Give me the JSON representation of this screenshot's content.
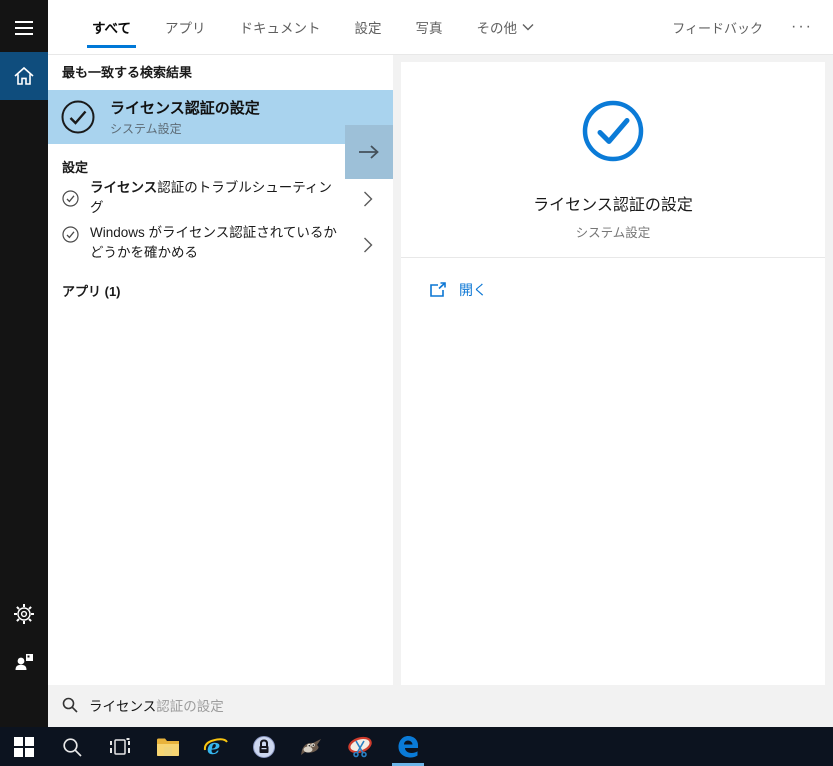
{
  "tabs": {
    "items": [
      {
        "label": "すべて",
        "active": true
      },
      {
        "label": "アプリ",
        "active": false
      },
      {
        "label": "ドキュメント",
        "active": false
      },
      {
        "label": "設定",
        "active": false
      },
      {
        "label": "写真",
        "active": false
      },
      {
        "label": "その他",
        "active": false,
        "has_chevron": true
      }
    ],
    "feedback_label": "フィードバック",
    "more_label": "···"
  },
  "sidebar": {
    "icons": [
      "hamburger-menu",
      "home",
      "settings-gear",
      "user-account"
    ],
    "selected": "home"
  },
  "left": {
    "best_match_header": "最も一致する検索結果",
    "best_match": {
      "title": "ライセンス認証の設定",
      "subtitle": "システム設定",
      "icon": "check-circle"
    },
    "settings_header": "設定",
    "settings_items": [
      {
        "bold": "ライセンス",
        "rest": "認証のトラブルシューティング",
        "icon": "check-circle"
      },
      {
        "text": "Windows がライセンス認証されているかどうかを確かめる",
        "icon": "check-circle"
      }
    ],
    "apps_header": "アプリ (1)"
  },
  "preview": {
    "icon": "check-circle-large",
    "title": "ライセンス認証の設定",
    "subtitle": "システム設定",
    "open_label": "開く"
  },
  "search": {
    "typed": "ライセンス",
    "suggestion": "認証の設定"
  },
  "taskbar": {
    "icons": [
      "start",
      "search",
      "task-view",
      "file-explorer",
      "internet-explorer",
      "keepass-lock",
      "gimp",
      "snipping-tool",
      "edge"
    ],
    "active_icon": "edge"
  },
  "colors": {
    "accent": "#0078d7",
    "sidebar-bg": "#141414",
    "home-tile": "#0f4d7d",
    "highlight": "#a9d3ee",
    "arrow-btn": "#9dc0d8",
    "taskbar": "#0c131f",
    "link": "#0b76d4",
    "edge-underline": "#6cb5e8"
  }
}
